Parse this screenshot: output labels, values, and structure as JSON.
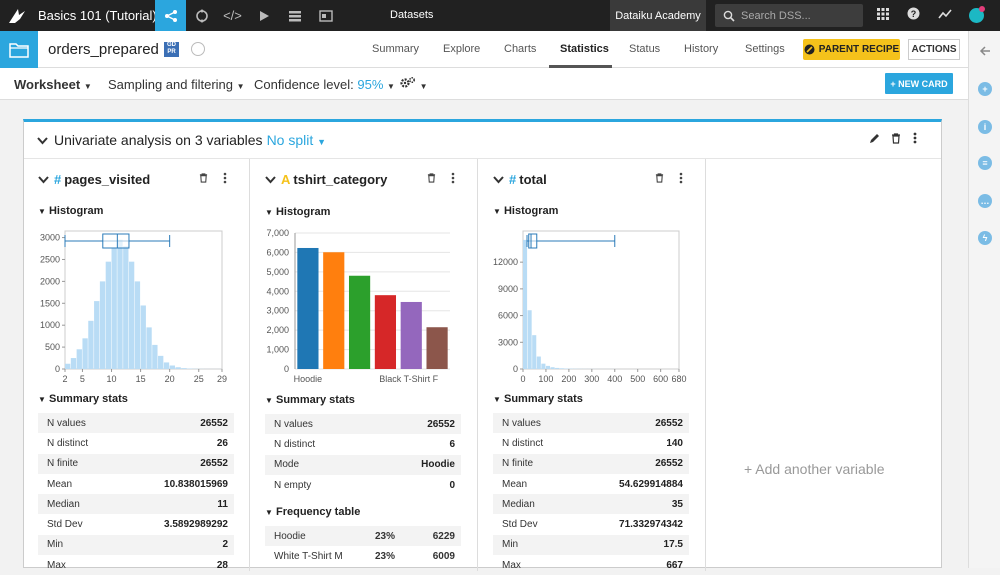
{
  "app": {
    "project": "Basics 101 (Tutorial)",
    "section": "Datasets",
    "academy": "Dataiku Academy",
    "search_placeholder": "Search DSS..."
  },
  "dataset": {
    "name": "orders_prepared",
    "badge": "GD PR"
  },
  "tabs": [
    "Summary",
    "Explore",
    "Charts",
    "Statistics",
    "Status",
    "History",
    "Settings"
  ],
  "active_tab": "Statistics",
  "buttons": {
    "parent_recipe": "PARENT RECIPE",
    "actions": "ACTIONS",
    "new_card": "+ NEW CARD"
  },
  "worksheet": {
    "label": "Worksheet",
    "sampling": "Sampling and filtering",
    "confidence_label": "Confidence level:",
    "confidence_value": "95%"
  },
  "card": {
    "title": "Univariate analysis on 3 variables",
    "split": "No split",
    "add_variable": "+ Add another variable"
  },
  "colors": {
    "accent": "#2ba6de",
    "parent_recipe": "#f5c21b",
    "hist_fill": "#b9dcf5"
  },
  "variables": [
    {
      "type_icon": "#",
      "name": "pages_visited",
      "histogram_label": "Histogram",
      "summary_label": "Summary stats",
      "stats": [
        {
          "label": "N values",
          "value": "26552"
        },
        {
          "label": "N distinct",
          "value": "26"
        },
        {
          "label": "N finite",
          "value": "26552"
        },
        {
          "label": "Mean",
          "value": "10.838015969"
        },
        {
          "label": "Median",
          "value": "11"
        },
        {
          "label": "Std Dev",
          "value": "3.5892989292"
        },
        {
          "label": "Min",
          "value": "2"
        },
        {
          "label": "Max",
          "value": "28"
        }
      ]
    },
    {
      "type_icon": "A",
      "name": "tshirt_category",
      "histogram_label": "Histogram",
      "summary_label": "Summary stats",
      "stats": [
        {
          "label": "N values",
          "value": "26552"
        },
        {
          "label": "N distinct",
          "value": "6"
        },
        {
          "label": "Mode",
          "value": "Hoodie"
        },
        {
          "label": "N empty",
          "value": "0"
        }
      ],
      "frequency_label": "Frequency table",
      "frequency": [
        {
          "label": "Hoodie",
          "pct": "23%",
          "count": "6229"
        },
        {
          "label": "White T-Shirt M",
          "pct": "23%",
          "count": "6009"
        }
      ]
    },
    {
      "type_icon": "#",
      "name": "total",
      "histogram_label": "Histogram",
      "summary_label": "Summary stats",
      "stats": [
        {
          "label": "N values",
          "value": "26552"
        },
        {
          "label": "N distinct",
          "value": "140"
        },
        {
          "label": "N finite",
          "value": "26552"
        },
        {
          "label": "Mean",
          "value": "54.629914884"
        },
        {
          "label": "Median",
          "value": "35"
        },
        {
          "label": "Std Dev",
          "value": "71.332974342"
        },
        {
          "label": "Min",
          "value": "17.5"
        },
        {
          "label": "Max",
          "value": "667"
        }
      ]
    }
  ],
  "chart_data": [
    {
      "type": "bar",
      "title": "",
      "x": [
        2,
        3,
        4,
        5,
        6,
        7,
        8,
        9,
        10,
        11,
        12,
        13,
        14,
        15,
        16,
        17,
        18,
        19,
        20,
        21,
        22,
        23,
        24,
        25,
        26,
        27,
        28
      ],
      "values": [
        120,
        250,
        450,
        700,
        1100,
        1550,
        2000,
        2450,
        2750,
        2950,
        2800,
        2450,
        2000,
        1450,
        950,
        550,
        300,
        150,
        80,
        40,
        20,
        10,
        5,
        3,
        2,
        1,
        1
      ],
      "xticks": [
        "2",
        "5",
        "10",
        "15",
        "20",
        "25",
        "29"
      ],
      "yticks": [
        "0",
        "500",
        "1000",
        "1500",
        "2000",
        "2500",
        "3000"
      ],
      "xlim": [
        2,
        29
      ],
      "ylim": [
        0,
        3150
      ],
      "boxplot": {
        "min": 2,
        "q1": 8.5,
        "median": 11,
        "q3": 13,
        "max": 20
      },
      "color": "#b9dcf5"
    },
    {
      "type": "bar",
      "title": "",
      "categories": [
        "Hoodie",
        "White T-Shirt M",
        "",
        "",
        "",
        "Black T-Shirt F"
      ],
      "xticks": [
        "Hoodie",
        "Black T-Shirt F"
      ],
      "values": [
        6229,
        6009,
        4800,
        3800,
        3450,
        2150
      ],
      "colors": [
        "#1f77b4",
        "#ff7f0e",
        "#2ca02c",
        "#d62728",
        "#9467bd",
        "#8c564b"
      ],
      "yticks": [
        "0",
        "1,000",
        "2,000",
        "3,000",
        "4,000",
        "5,000",
        "6,000",
        "7,000"
      ],
      "ylim": [
        0,
        7000
      ]
    },
    {
      "type": "bar",
      "title": "",
      "x": [
        0,
        20,
        40,
        60,
        80,
        100,
        120,
        140,
        160,
        180,
        200,
        220,
        240,
        260,
        280,
        300,
        320,
        340,
        360,
        380,
        400
      ],
      "values": [
        14500,
        6600,
        3800,
        1400,
        600,
        350,
        200,
        120,
        80,
        50,
        40,
        30,
        20,
        15,
        10,
        10,
        8,
        6,
        5,
        5,
        4
      ],
      "xticks": [
        "0",
        "100",
        "200",
        "300",
        "400",
        "500",
        "600",
        "680"
      ],
      "yticks": [
        "0",
        "3000",
        "6000",
        "9000",
        "12000"
      ],
      "xlim": [
        0,
        680
      ],
      "ylim": [
        0,
        15500
      ],
      "boxplot": {
        "min": 17.5,
        "q1": 25,
        "median": 35,
        "q3": 60,
        "max": 400
      },
      "color": "#b9dcf5"
    }
  ]
}
